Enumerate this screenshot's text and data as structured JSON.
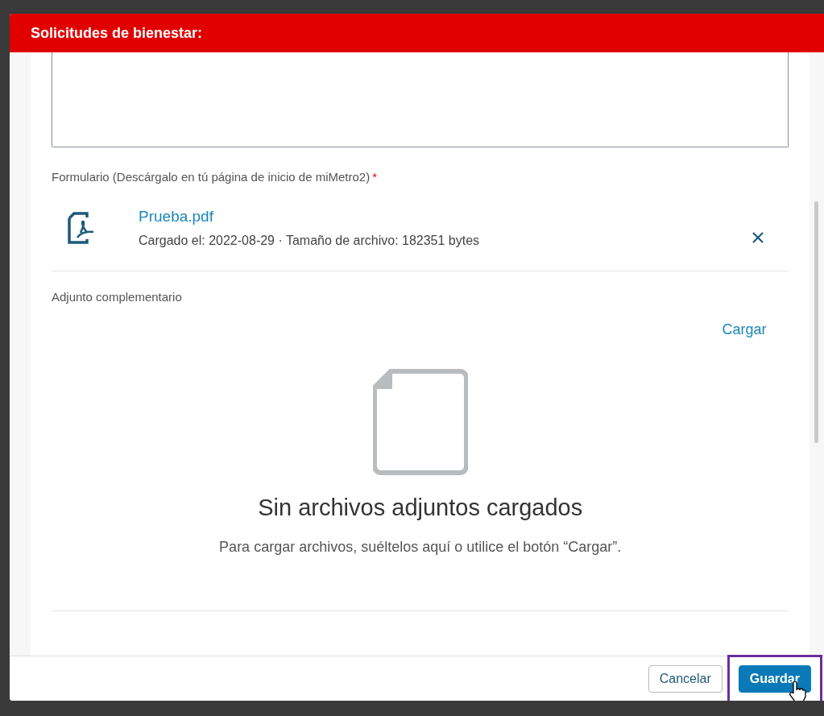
{
  "dialog": {
    "title": "Solicitudes de bienestar:"
  },
  "form_field": {
    "label": "Formulario (Descárgalo en tú página de inicio de miMetro2)",
    "required_mark": "*",
    "file": {
      "name": "Prueba.pdf",
      "meta": "Cargado el: 2022-08-29 · Tamaño de archivo: 182351 bytes"
    }
  },
  "attachment": {
    "label": "Adjunto complementario",
    "upload_link": "Cargar",
    "empty_title": "Sin archivos adjuntos cargados",
    "empty_text": "Para cargar archivos, suéltelos aquí o utilice el botón “Cargar”."
  },
  "footer": {
    "buttons": [
      {
        "label": "Cancelar",
        "kind": "secondary",
        "highlighted": false
      },
      {
        "label": "Guardar",
        "kind": "primary",
        "highlighted": true
      }
    ]
  }
}
